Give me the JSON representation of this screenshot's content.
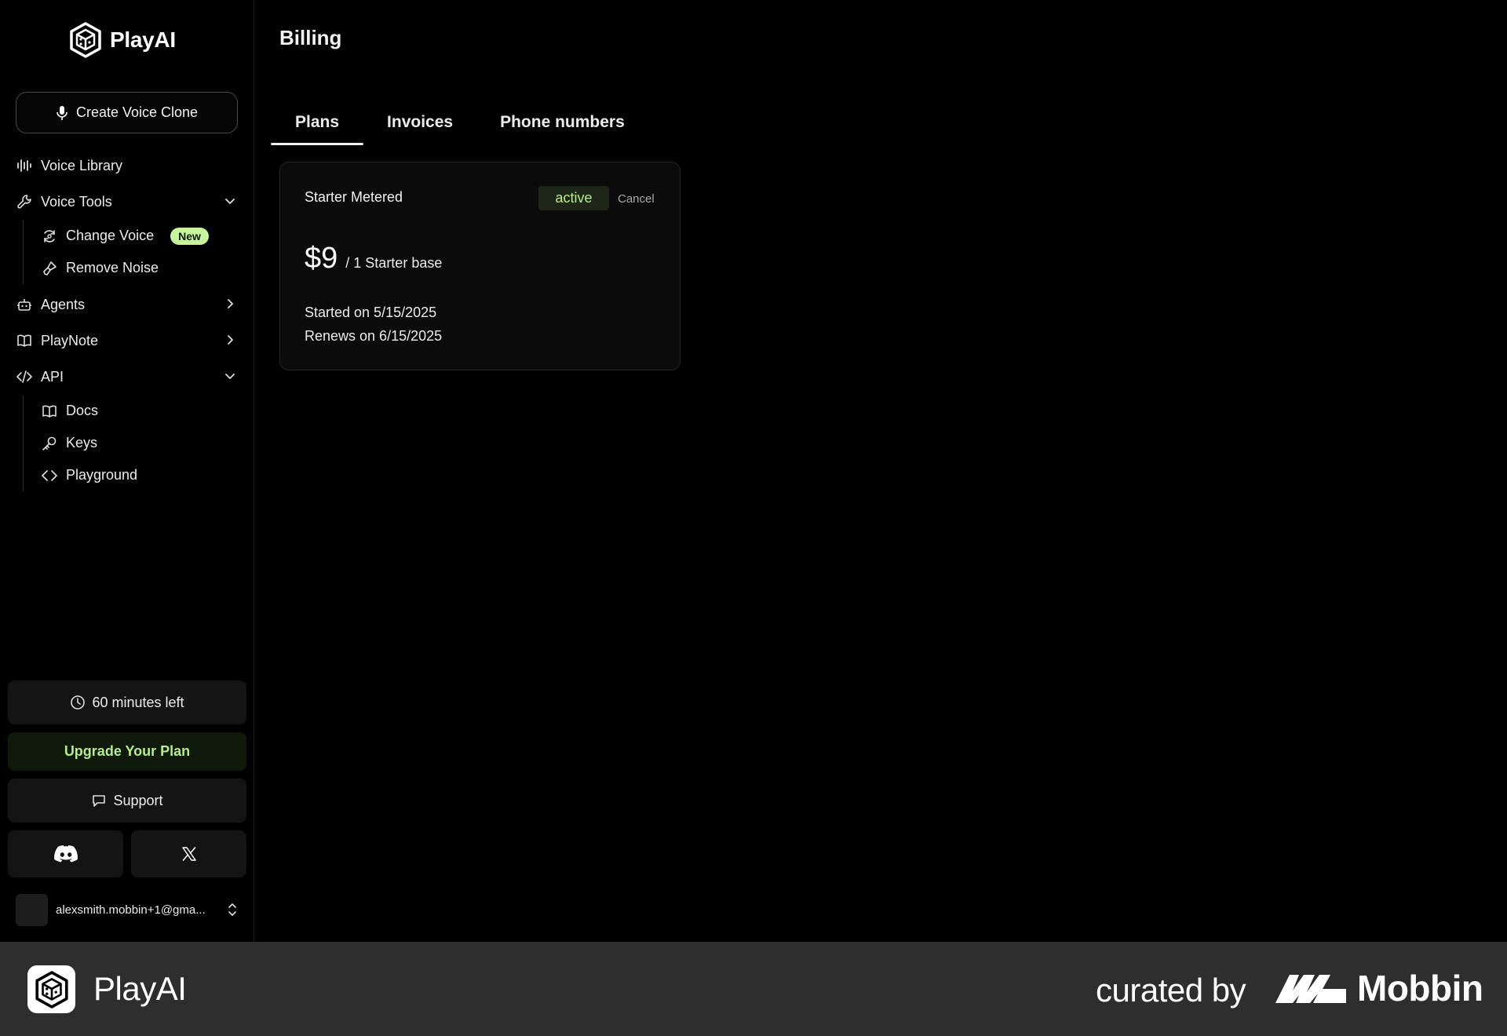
{
  "app": {
    "name": "PlayAI"
  },
  "sidebar": {
    "create_button": "Create Voice Clone",
    "items": {
      "voice_library": "Voice Library",
      "voice_tools": "Voice Tools",
      "change_voice": "Change Voice",
      "new_badge": "New",
      "remove_noise": "Remove Noise",
      "agents": "Agents",
      "playnote": "PlayNote",
      "api": "API",
      "docs": "Docs",
      "keys": "Keys",
      "playground": "Playground"
    },
    "minutes_left": "60 minutes left",
    "upgrade": "Upgrade Your Plan",
    "support": "Support",
    "user_email": "alexsmith.mobbin+1@gma..."
  },
  "main": {
    "title": "Billing",
    "tabs": [
      "Plans",
      "Invoices",
      "Phone numbers"
    ],
    "plan": {
      "name": "Starter Metered",
      "status": "active",
      "cancel": "Cancel",
      "price": "$9",
      "price_unit": "/ 1 Starter base",
      "started": "Started on 5/15/2025",
      "renews": "Renews on 6/15/2025"
    }
  },
  "footer": {
    "app_name": "PlayAI",
    "curated_by": "curated by",
    "brand": "Mobbin"
  },
  "colors": {
    "accent_green": "#b6ec8a",
    "badge_green": "#c8f59b",
    "background": "#000000",
    "footer_bg": "#2e2e2e"
  }
}
